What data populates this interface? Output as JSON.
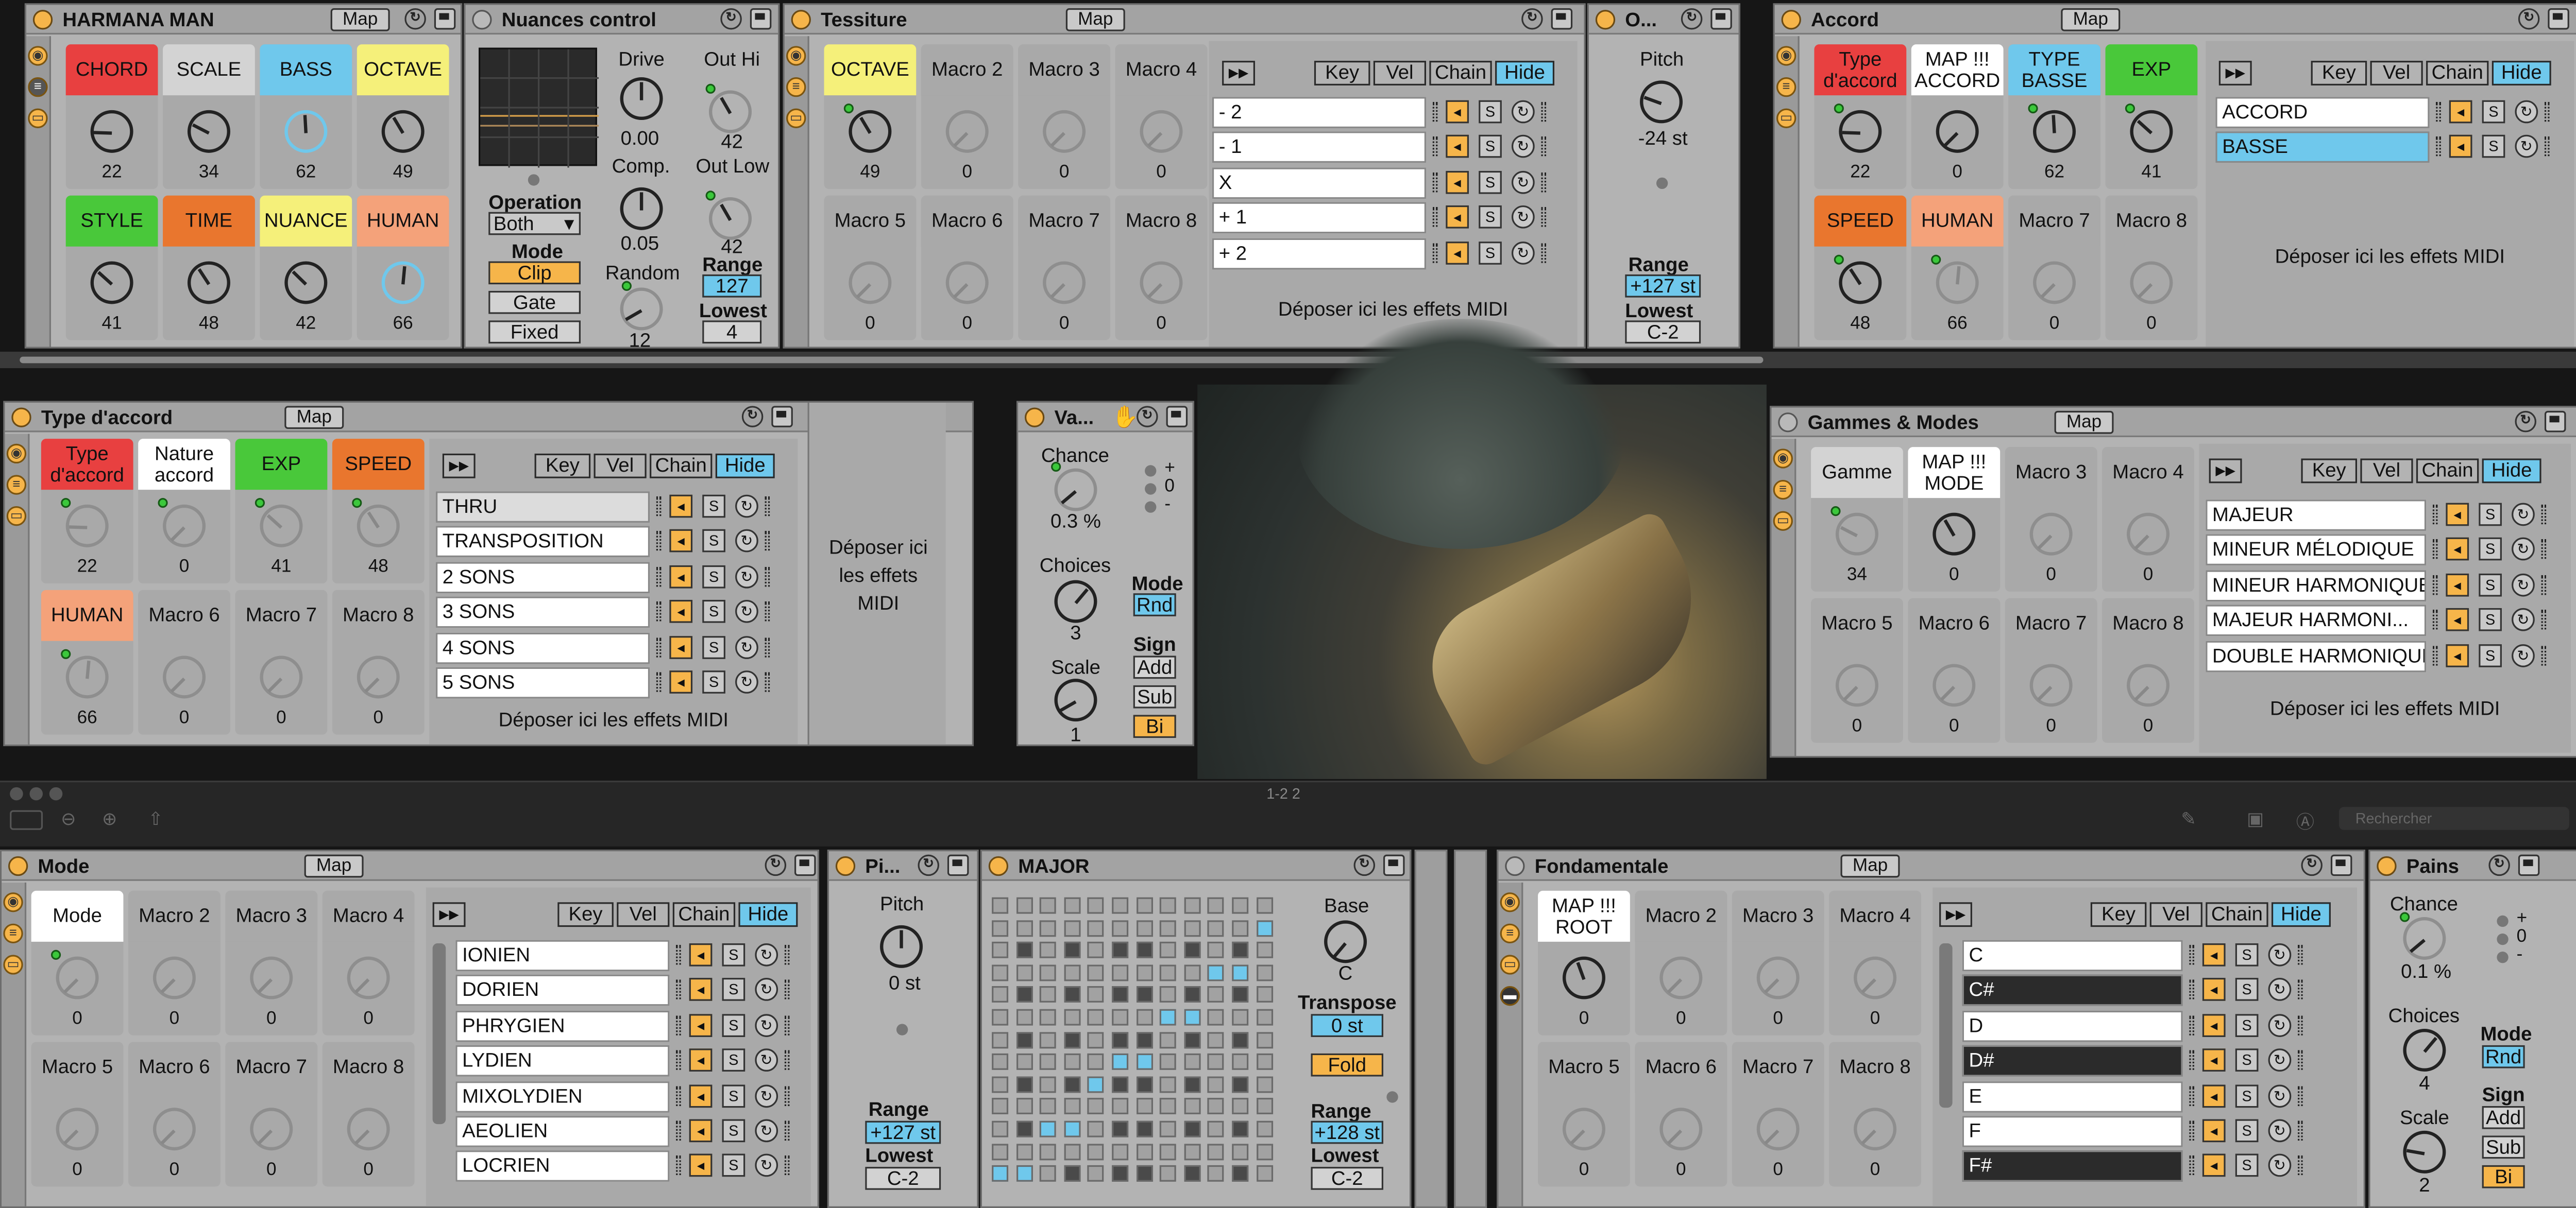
{
  "colors": {
    "panel": "#b3b3b3",
    "header": "#a3a3a3",
    "orange": "#f6b54a",
    "blue": "#6fc8ec",
    "red": "#e84040",
    "green": "#49c83a",
    "yellow": "#f5f07a",
    "grey_cell": "#a9a9a9",
    "dark_bg": "#161616"
  },
  "common": {
    "map": "Map",
    "key": "Key",
    "vel": "Vel",
    "chain": "Chain",
    "hide": "Hide",
    "s": "S",
    "drop": "Déposer ici les effets MIDI",
    "drop_short": "Déposer ici les effets MIDI"
  },
  "harmana": {
    "title": "HARMANA MAN",
    "macros": [
      {
        "label": "CHORD",
        "value": "22"
      },
      {
        "label": "SCALE",
        "value": "34"
      },
      {
        "label": "BASS",
        "value": "62"
      },
      {
        "label": "OCTAVE",
        "value": "49"
      },
      {
        "label": "STYLE",
        "value": "41"
      },
      {
        "label": "TIME",
        "value": "48"
      },
      {
        "label": "NUANCE",
        "value": "42"
      },
      {
        "label": "HUMAN",
        "value": "66"
      }
    ]
  },
  "nuances": {
    "title": "Nuances control",
    "drive_label": "Drive",
    "drive": "0.00",
    "comp_label": "Comp.",
    "comp": "0.05",
    "random_label": "Random",
    "random": "12",
    "outhi_label": "Out Hi",
    "outhi": "42",
    "outlow_label": "Out Low",
    "outlow": "42",
    "operation_label": "Operation",
    "operation": "Both",
    "mode_label": "Mode",
    "modes": [
      "Clip",
      "Gate",
      "Fixed"
    ],
    "range_label": "Range",
    "range": "127",
    "lowest_label": "Lowest",
    "lowest": "4"
  },
  "tessiture": {
    "title": "Tessiture",
    "macros": [
      {
        "label": "OCTAVE",
        "value": "49"
      },
      {
        "label": "Macro 2",
        "value": "0"
      },
      {
        "label": "Macro 3",
        "value": "0"
      },
      {
        "label": "Macro 4",
        "value": "0"
      },
      {
        "label": "Macro 5",
        "value": "0"
      },
      {
        "label": "Macro 6",
        "value": "0"
      },
      {
        "label": "Macro 7",
        "value": "0"
      },
      {
        "label": "Macro 8",
        "value": "0"
      }
    ],
    "chains": [
      "- 2",
      "- 1",
      "X",
      "+ 1",
      "+ 2"
    ]
  },
  "octave_dev": {
    "title": "O...",
    "pitch_label": "Pitch",
    "pitch": "-24 st",
    "range_label": "Range",
    "range": "+127 st",
    "lowest_label": "Lowest",
    "lowest": "C-2"
  },
  "accord": {
    "title": "Accord",
    "macros": [
      {
        "label": "Type d'accord",
        "value": "22"
      },
      {
        "label": "MAP !!! ACCORD",
        "value": "0"
      },
      {
        "label": "TYPE BASSE",
        "value": "62"
      },
      {
        "label": "EXP",
        "value": "41"
      },
      {
        "label": "SPEED",
        "value": "48"
      },
      {
        "label": "HUMAN",
        "value": "66"
      },
      {
        "label": "Macro 7",
        "value": "0"
      },
      {
        "label": "Macro 8",
        "value": "0"
      }
    ],
    "chains": [
      "ACCORD",
      "BASSE"
    ]
  },
  "type_accord": {
    "title": "Type d'accord",
    "macros": [
      {
        "label": "Type d'accord",
        "value": "22"
      },
      {
        "label": "Nature accord",
        "value": "0"
      },
      {
        "label": "EXP",
        "value": "41"
      },
      {
        "label": "SPEED",
        "value": "48"
      },
      {
        "label": "HUMAN",
        "value": "66"
      },
      {
        "label": "Macro 6",
        "value": "0"
      },
      {
        "label": "Macro 7",
        "value": "0"
      },
      {
        "label": "Macro 8",
        "value": "0"
      }
    ],
    "chains": [
      "THRU",
      "TRANSPOSITION",
      "2 SONS",
      "3 SONS",
      "4 SONS",
      "5 SONS"
    ],
    "drop_side": "Déposer ici les effets MIDI"
  },
  "velocity": {
    "title": "Va...",
    "chance_label": "Chance",
    "chance": "0.3 %",
    "choices_label": "Choices",
    "choices": "3",
    "scale_label": "Scale",
    "scale": "1",
    "mode_label": "Mode",
    "mode": "Rnd",
    "sign_label": "Sign",
    "signs": [
      "Add",
      "Sub",
      "Bi"
    ],
    "plus": "+",
    "zero": "0",
    "minus": "-"
  },
  "gammes": {
    "title": "Gammes & Modes",
    "macros": [
      {
        "label": "Gamme",
        "value": "34"
      },
      {
        "label": "MAP !!! MODE",
        "value": "0"
      },
      {
        "label": "Macro 3",
        "value": "0"
      },
      {
        "label": "Macro 4",
        "value": "0"
      },
      {
        "label": "Macro 5",
        "value": "0"
      },
      {
        "label": "Macro 6",
        "value": "0"
      },
      {
        "label": "Macro 7",
        "value": "0"
      },
      {
        "label": "Macro 8",
        "value": "0"
      }
    ],
    "chains": [
      "MAJEUR",
      "MINEUR MÉLODIQUE",
      "MINEUR HARMONIQUE",
      "MAJEUR HARMONI...",
      "DOUBLE HARMONIQUE"
    ]
  },
  "midbar": {
    "filename": "1-2 2",
    "search_placeholder": "Rechercher"
  },
  "mode": {
    "title": "Mode",
    "macros": [
      {
        "label": "Mode",
        "value": "0"
      },
      {
        "label": "Macro 2",
        "value": "0"
      },
      {
        "label": "Macro 3",
        "value": "0"
      },
      {
        "label": "Macro 4",
        "value": "0"
      },
      {
        "label": "Macro 5",
        "value": "0"
      },
      {
        "label": "Macro 6",
        "value": "0"
      },
      {
        "label": "Macro 7",
        "value": "0"
      },
      {
        "label": "Macro 8",
        "value": "0"
      }
    ],
    "chains": [
      "IONIEN",
      "DORIEN",
      "PHRYGIEN",
      "LYDIEN",
      "MIXOLYDIEN",
      "AEOLIEN",
      "LOCRIEN"
    ]
  },
  "pitch_dev": {
    "title": "Pi...",
    "pitch_label": "Pitch",
    "pitch": "0 st",
    "range_label": "Range",
    "range": "+127 st",
    "lowest_label": "Lowest",
    "lowest": "C-2"
  },
  "major": {
    "title": "MAJOR",
    "base_label": "Base",
    "base": "C",
    "transpose_label": "Transpose",
    "transpose": "0 st",
    "fold": "Fold",
    "range_label": "Range",
    "range": "+128 st",
    "lowest_label": "Lowest",
    "lowest": "C-2"
  },
  "fondamentale": {
    "title": "Fondamentale",
    "macros": [
      {
        "label": "MAP !!! ROOT",
        "value": "0"
      },
      {
        "label": "Macro 2",
        "value": "0"
      },
      {
        "label": "Macro 3",
        "value": "0"
      },
      {
        "label": "Macro 4",
        "value": "0"
      },
      {
        "label": "Macro 5",
        "value": "0"
      },
      {
        "label": "Macro 6",
        "value": "0"
      },
      {
        "label": "Macro 7",
        "value": "0"
      },
      {
        "label": "Macro 8",
        "value": "0"
      }
    ],
    "chains": [
      "C",
      "C#",
      "D",
      "D#",
      "E",
      "F",
      "F#"
    ]
  },
  "pains": {
    "title": "Pains",
    "chance_label": "Chance",
    "chance": "0.1 %",
    "choices_label": "Choices",
    "choices": "4",
    "scale_label": "Scale",
    "scale": "2",
    "mode_label": "Mode",
    "mode": "Rnd",
    "sign_label": "Sign",
    "signs": [
      "Add",
      "Sub",
      "Bi"
    ],
    "plus": "+",
    "zero": "0",
    "minus": "-"
  }
}
